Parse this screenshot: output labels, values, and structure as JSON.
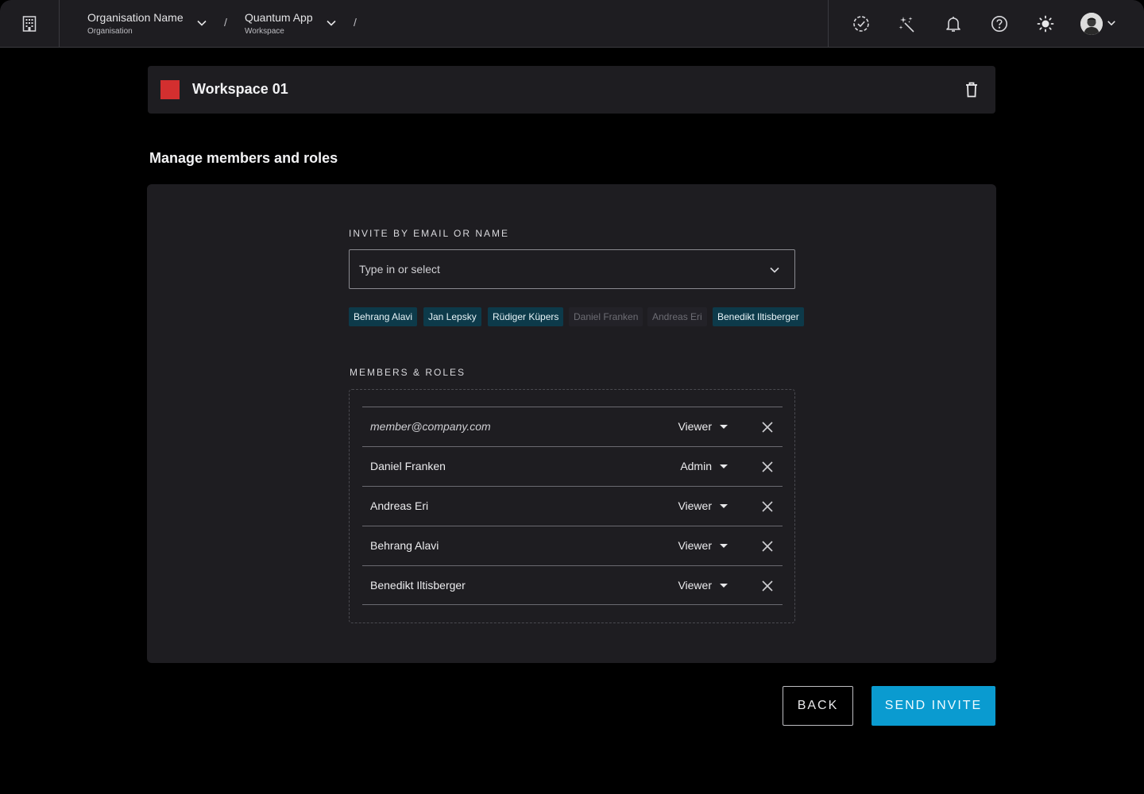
{
  "topbar": {
    "org_name": "Organisation Name",
    "org_sub": "Organisation",
    "app_name": "Quantum App",
    "app_sub": "Workspace",
    "separator": "/",
    "icons": [
      "building-icon",
      "task-check-icon",
      "magic-wand-icon",
      "bell-icon",
      "help-icon",
      "theme-sun-icon",
      "avatar"
    ]
  },
  "workspace": {
    "title": "Workspace 01",
    "color": "#d32f2f"
  },
  "section": {
    "title": "Manage members and roles"
  },
  "invite": {
    "label": "INVITE BY EMAIL OR NAME",
    "placeholder": "Type in or select",
    "chips": [
      {
        "label": "Behrang Alavi",
        "state": "active"
      },
      {
        "label": "Jan Lepsky",
        "state": "active"
      },
      {
        "label": "Rüdiger Küpers",
        "state": "active"
      },
      {
        "label": "Daniel Franken",
        "state": "inactive"
      },
      {
        "label": "Andreas Eri",
        "state": "inactive"
      },
      {
        "label": "Benedikt Iltisberger",
        "state": "active"
      }
    ]
  },
  "members": {
    "label": "MEMBERS & ROLES",
    "rows": [
      {
        "name": "member@company.com",
        "role": "Viewer"
      },
      {
        "name": "Daniel Franken",
        "role": "Admin"
      },
      {
        "name": "Andreas Eri",
        "role": "Viewer"
      },
      {
        "name": "Behrang Alavi",
        "role": "Viewer"
      },
      {
        "name": "Benedikt Iltisberger",
        "role": "Viewer"
      }
    ]
  },
  "buttons": {
    "back": "BACK",
    "send": "SEND INVITE"
  },
  "colors": {
    "accent": "#0a9bd0",
    "chip_active_bg": "#0d3a4a",
    "panel_bg": "#1e1d21"
  }
}
